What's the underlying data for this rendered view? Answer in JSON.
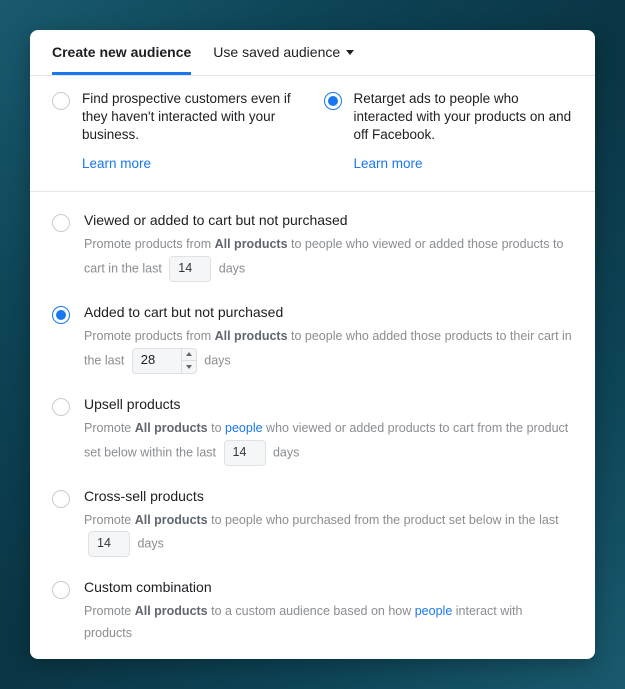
{
  "tabs": {
    "create": "Create new audience",
    "saved": "Use saved audience"
  },
  "top": {
    "prospective": {
      "text": "Find prospective customers even if they haven't interacted with your business.",
      "learn": "Learn more",
      "selected": false
    },
    "retarget": {
      "text": "Retarget ads to people who interacted with your products on and off Facebook.",
      "learn": "Learn more",
      "selected": true
    }
  },
  "opts": {
    "viewed": {
      "title": "Viewed or added to cart but not purchased",
      "desc_pre": "Promote products from ",
      "desc_strong": "All products",
      "desc_mid": " to people who viewed or added those products to cart in the last ",
      "value": "14",
      "desc_post": " days",
      "selected": false
    },
    "added": {
      "title": "Added to cart but not purchased",
      "desc_pre": "Promote products from ",
      "desc_strong": "All products",
      "desc_mid": " to people who added those products to their cart in the last ",
      "value": "28",
      "desc_post": " days",
      "selected": true
    },
    "upsell": {
      "title": "Upsell products",
      "desc_pre": "Promote ",
      "desc_strong": "All products",
      "desc_mid_a": " to ",
      "link": "people",
      "desc_mid_b": " who viewed or added products to cart from the product set below within the last ",
      "value": "14",
      "desc_post": " days",
      "selected": false
    },
    "cross": {
      "title": "Cross-sell products",
      "desc_pre": "Promote ",
      "desc_strong": "All products",
      "desc_mid": " to people who purchased from the product set below in the last ",
      "value": "14",
      "desc_post": " days",
      "selected": false
    },
    "custom": {
      "title": "Custom combination",
      "desc_pre": "Promote ",
      "desc_strong": "All products",
      "desc_mid_a": " to a custom audience based on how ",
      "link": "people",
      "desc_mid_b": " interact with products",
      "selected": false
    }
  }
}
